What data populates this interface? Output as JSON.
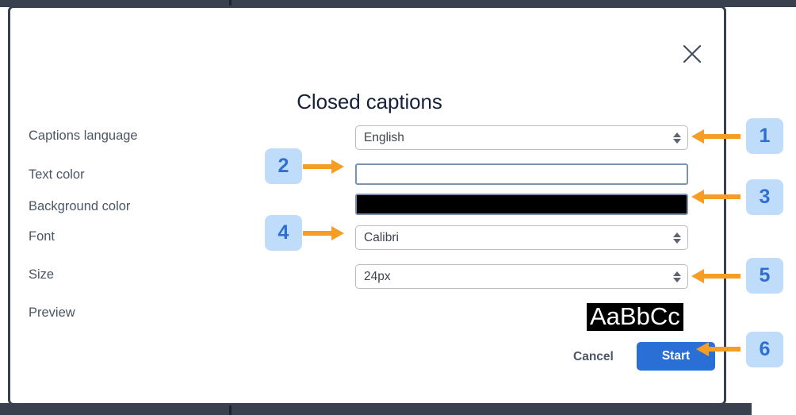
{
  "dialog": {
    "title": "Closed captions",
    "close_icon": "close-icon"
  },
  "fields": [
    {
      "id": "captions-language",
      "label": "Captions language",
      "type": "select",
      "value": "English",
      "options": [
        "English"
      ]
    },
    {
      "id": "text-color",
      "label": "Text color",
      "type": "color",
      "value": "#ffffff"
    },
    {
      "id": "background-color",
      "label": "Background color",
      "type": "color",
      "value": "#000000"
    },
    {
      "id": "font",
      "label": "Font",
      "type": "select",
      "value": "Calibri",
      "options": [
        "Calibri"
      ]
    },
    {
      "id": "size",
      "label": "Size",
      "type": "select",
      "value": "24px",
      "options": [
        "24px"
      ]
    },
    {
      "id": "preview",
      "label": "Preview",
      "type": "preview",
      "value": "AaBbCc"
    }
  ],
  "footer": {
    "cancel_label": "Cancel",
    "start_label": "Start"
  },
  "annotations": [
    {
      "number": "1",
      "target": "captions-language-select"
    },
    {
      "number": "2",
      "target": "text-color-swatch"
    },
    {
      "number": "3",
      "target": "background-color-swatch"
    },
    {
      "number": "4",
      "target": "font-select"
    },
    {
      "number": "5",
      "target": "size-select"
    },
    {
      "number": "6",
      "target": "start-button"
    }
  ],
  "colors": {
    "accent_blue": "#2a6fd6",
    "badge_bg": "#bfdcfb",
    "badge_text": "#2f6fd0",
    "arrow_orange": "#f59d24",
    "frame_dark": "#39404e",
    "label_gray": "#4b5565",
    "title_navy": "#16203a"
  }
}
